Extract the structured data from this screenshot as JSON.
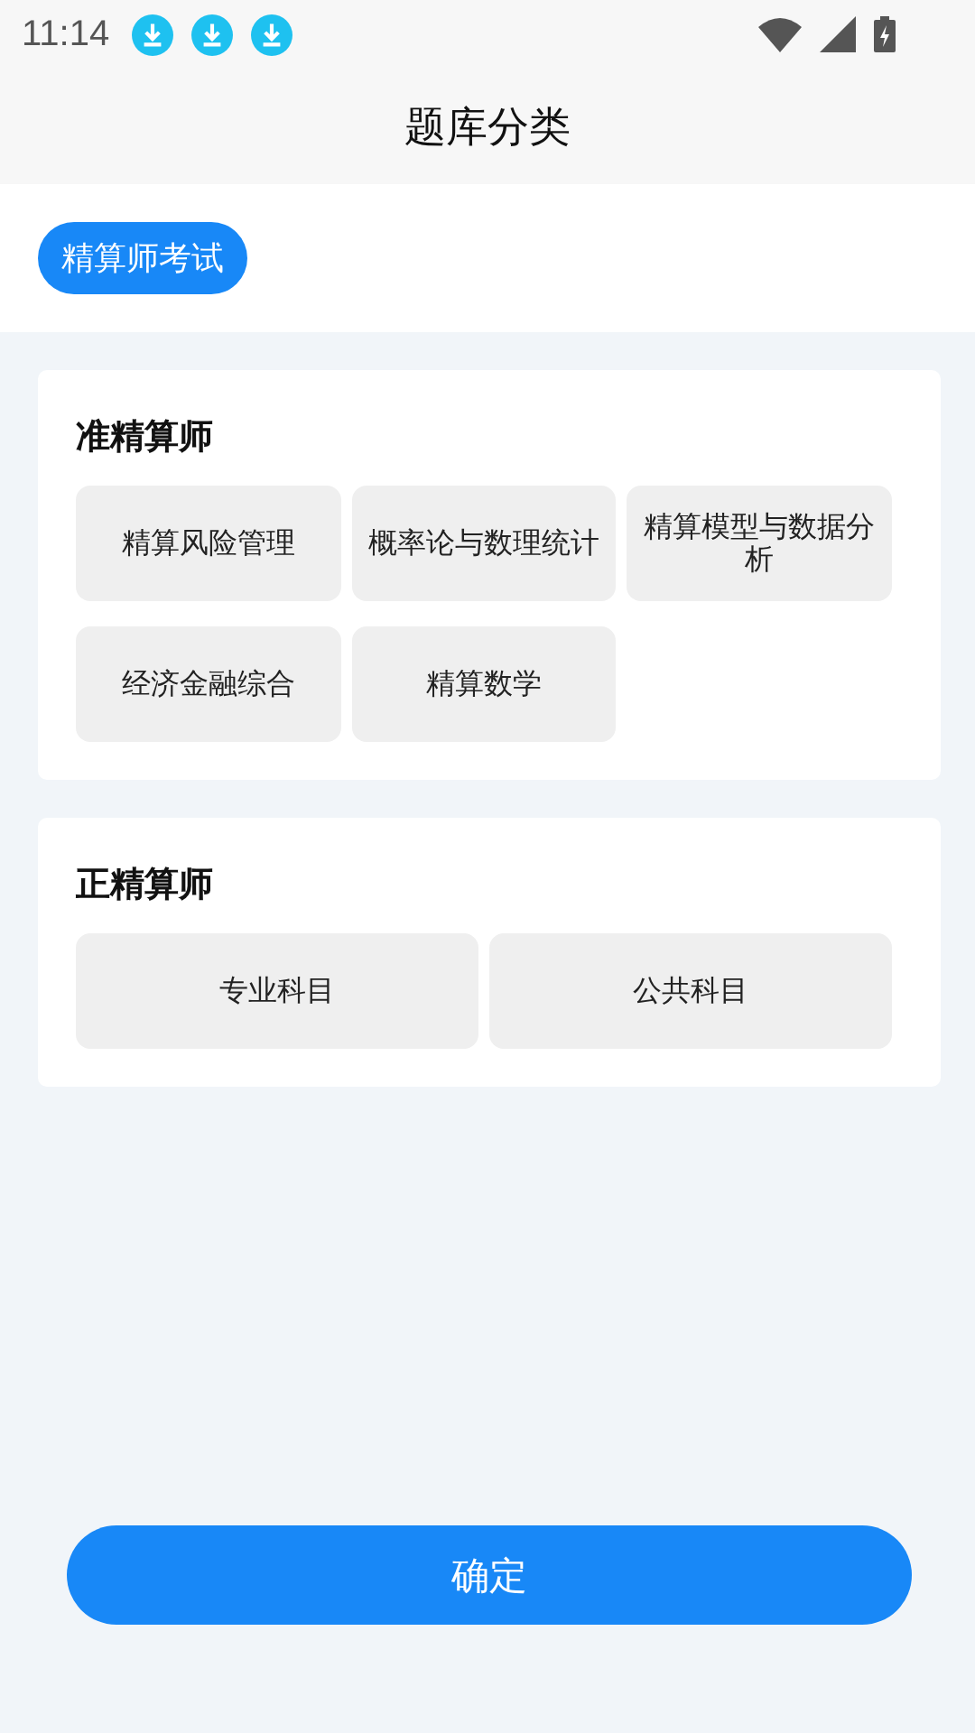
{
  "status_bar": {
    "time": "11:14",
    "notifications": [
      {
        "kind": "download"
      },
      {
        "kind": "download"
      },
      {
        "kind": "download"
      }
    ]
  },
  "title": "题库分类",
  "tabs": [
    {
      "label": "精算师考试",
      "selected": true
    }
  ],
  "sections": [
    {
      "title": "准精算师",
      "items": [
        "精算风险管理",
        "概率论与数理统计",
        "精算模型与数据分析",
        "经济金融综合",
        "精算数学"
      ]
    },
    {
      "title": "正精算师",
      "items": [
        "专业科目",
        "公共科目"
      ]
    }
  ],
  "confirm_button": "确定"
}
